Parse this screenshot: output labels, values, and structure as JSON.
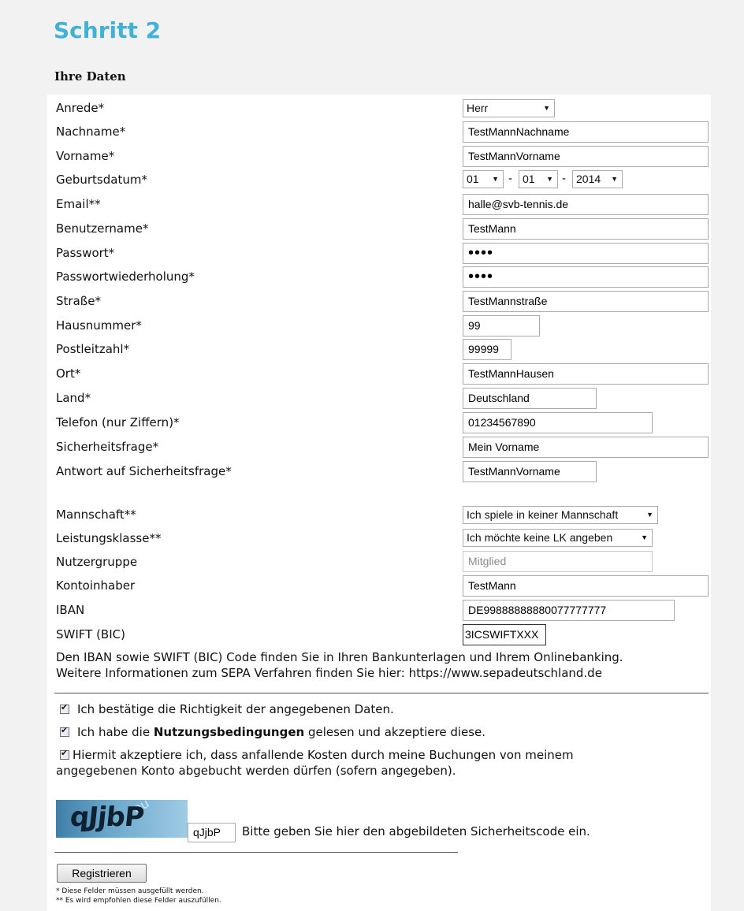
{
  "page_title": "Schritt 2",
  "section_title": "Ihre Daten",
  "fields": {
    "anrede": {
      "label": "Anrede*",
      "value": "Herr"
    },
    "nachname": {
      "label": "Nachname*",
      "value": "TestMannNachname"
    },
    "vorname": {
      "label": "Vorname*",
      "value": "TestMannVorname"
    },
    "geburtsdatum": {
      "label": "Geburtsdatum*",
      "day": "01",
      "month": "01",
      "year": "2014",
      "separator": "-"
    },
    "email": {
      "label": "Email**",
      "value": "halle@svb-tennis.de"
    },
    "benutzername": {
      "label": "Benutzername*",
      "value": "TestMann"
    },
    "passwort": {
      "label": "Passwort*",
      "value": "••••"
    },
    "passwort2": {
      "label": "Passwortwiederholung*",
      "value": "••••"
    },
    "strasse": {
      "label": "Straße*",
      "value": "TestMannstraße"
    },
    "hausnummer": {
      "label": "Hausnummer*",
      "value": "99"
    },
    "plz": {
      "label": "Postleitzahl*",
      "value": "99999"
    },
    "ort": {
      "label": "Ort*",
      "value": "TestMannHausen"
    },
    "land": {
      "label": "Land*",
      "value": "Deutschland"
    },
    "telefon": {
      "label": "Telefon (nur Ziffern)*",
      "value": "01234567890"
    },
    "sicherheitsfrage": {
      "label": "Sicherheitsfrage*",
      "value": "Mein Vorname"
    },
    "antwort": {
      "label": "Antwort auf Sicherheitsfrage*",
      "value": "TestMannVorname"
    },
    "mannschaft": {
      "label": "Mannschaft**",
      "value": "Ich spiele in keiner Mannschaft"
    },
    "leistungsklasse": {
      "label": "Leistungsklasse**",
      "value": "Ich möchte keine LK angeben"
    },
    "nutzergruppe": {
      "label": "Nutzergruppe",
      "value": "Mitglied"
    },
    "kontoinhaber": {
      "label": "Kontoinhaber",
      "value": "TestMann"
    },
    "iban": {
      "label": "IBAN",
      "value": "DE99888888880077777777"
    },
    "swift": {
      "label": "SWIFT (BIC)",
      "value": "3ICSWIFTXXX"
    }
  },
  "info": {
    "line1": "Den IBAN sowie SWIFT (BIC) Code finden Sie in Ihren Bankunterlagen und Ihrem Onlinebanking.",
    "line2": "Weitere Informationen zum SEPA Verfahren finden Sie hier: https://www.sepadeutschland.de"
  },
  "checks": {
    "c1": "Ich bestätige die Richtigkeit der angegebenen Daten.",
    "c2_pre": "Ich habe die ",
    "c2_bold": "Nutzungsbedingungen",
    "c2_post": " gelesen und akzeptiere diese.",
    "c3_line1": "Hiermit akzeptiere ich, dass anfallende Kosten durch meine Buchungen von meinem",
    "c3_line2": "angegebenen Konto abgebucht werden dürfen (sofern angegeben)."
  },
  "captcha": {
    "image_text": "qJjbP",
    "input_value": "qJjbP",
    "instruction": "Bitte geben Sie hier den abgebildeten Sicherheitscode ein."
  },
  "submit_label": "Registrieren",
  "footnotes": {
    "f1": "* Diese Felder müssen ausgefüllt werden.",
    "f2": "** Es wird empfohlen diese Felder auszufüllen."
  }
}
